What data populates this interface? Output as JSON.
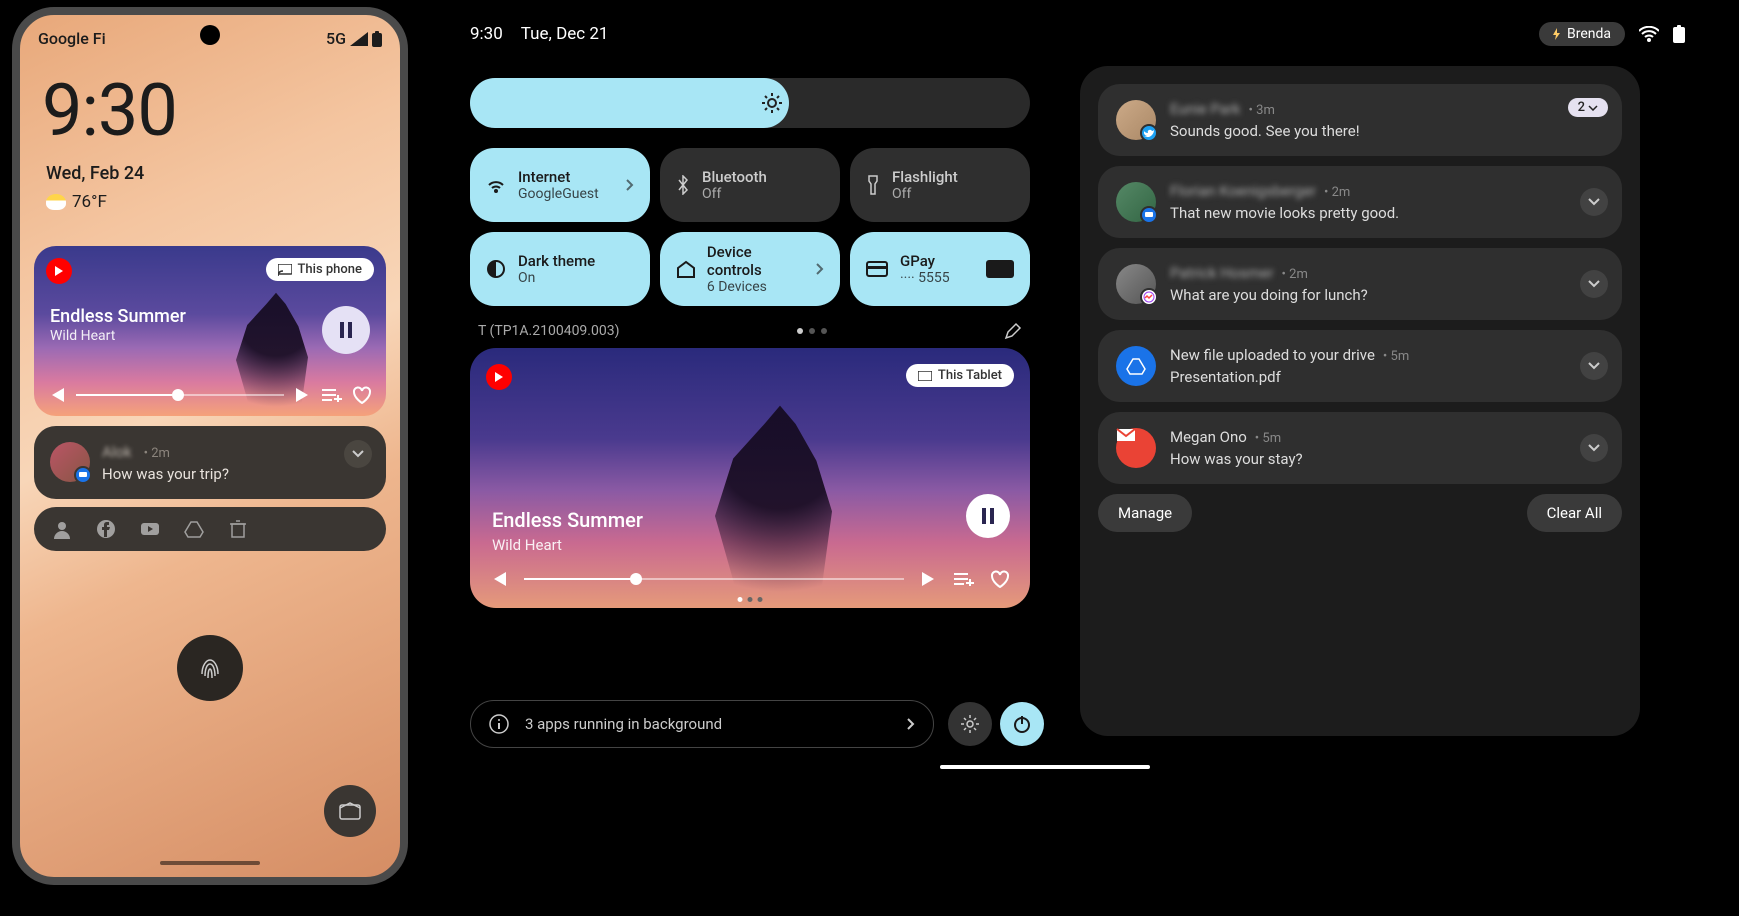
{
  "phone": {
    "carrier": "Google Fi",
    "network": "5G",
    "clock": "9:30",
    "date": "Wed, Feb 24",
    "temp": "76°F",
    "media": {
      "cast_label": "This phone",
      "title": "Endless Summer",
      "artist": "Wild Heart"
    },
    "notification": {
      "sender": "Alok",
      "time": "2m",
      "message": "How was your trip?"
    }
  },
  "tablet": {
    "clock": "9:30",
    "date": "Tue, Dec 21",
    "user": "Brenda",
    "tiles": {
      "internet": {
        "label": "Internet",
        "sub": "GoogleGuest"
      },
      "bluetooth": {
        "label": "Bluetooth",
        "sub": "Off"
      },
      "flashlight": {
        "label": "Flashlight",
        "sub": "Off"
      },
      "darktheme": {
        "label": "Dark theme",
        "sub": "On"
      },
      "devicecontrols": {
        "label": "Device controls",
        "sub": "6 Devices"
      },
      "gpay": {
        "label": "GPay",
        "sub": "···· 5555"
      }
    },
    "build": "T (TP1A.2100409.003)",
    "media": {
      "cast_label": "This Tablet",
      "title": "Endless Summer",
      "artist": "Wild Heart"
    },
    "bg_apps": "3 apps running in background",
    "notifications": [
      {
        "sender": "Eunie Park",
        "time": "3m",
        "message": "Sounds good. See you there!",
        "count": "2",
        "app": "twitter",
        "blur": true
      },
      {
        "sender": "Florian Koenigsberger",
        "time": "2m",
        "message": "That new movie looks pretty good.",
        "app": "messages",
        "blur": true
      },
      {
        "sender": "Patrick Hosmer",
        "time": "2m",
        "message": "What are you doing for lunch?",
        "app": "messenger",
        "blur": true
      },
      {
        "sender": "New file uploaded to your drive",
        "time": "5m",
        "message": "Presentation.pdf",
        "app": "drive",
        "blur": false
      },
      {
        "sender": "Megan Ono",
        "time": "5m",
        "message": "How was your stay?",
        "app": "gmail",
        "blur": false
      }
    ],
    "manage": "Manage",
    "clear_all": "Clear All"
  }
}
